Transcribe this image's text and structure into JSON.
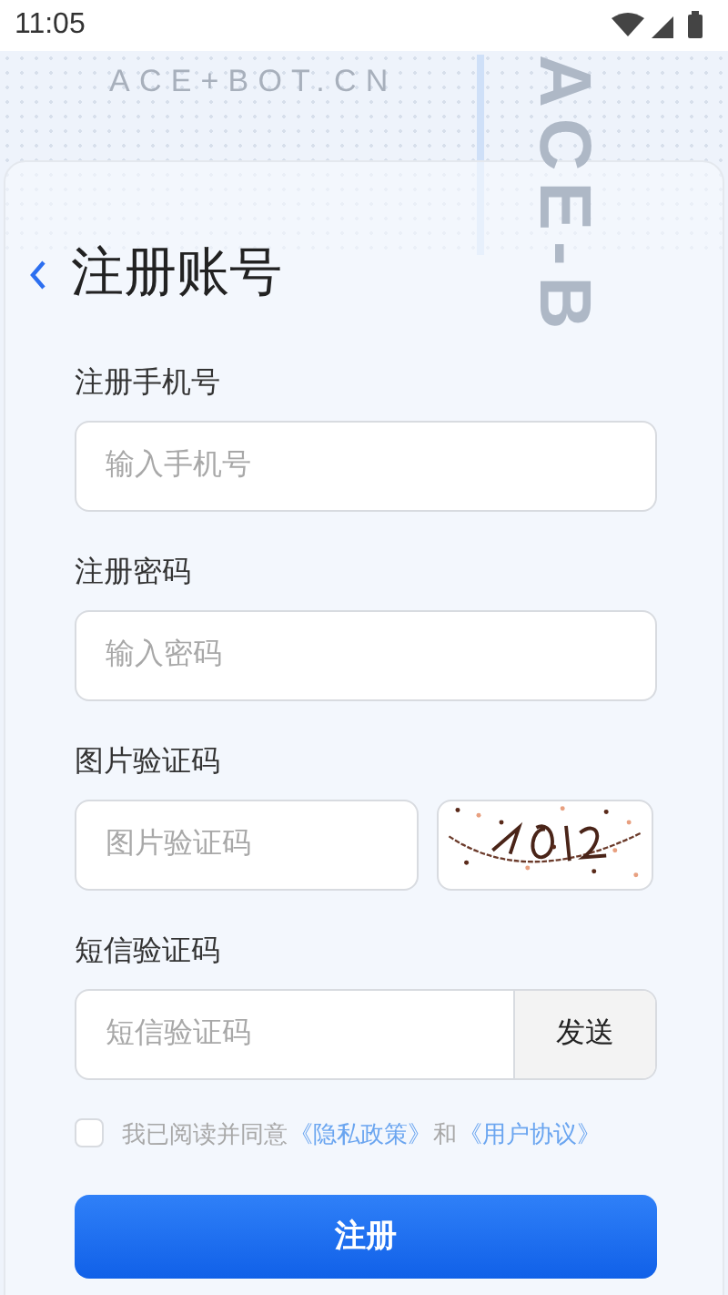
{
  "status_bar": {
    "time": "11:05"
  },
  "decor": {
    "header_text": "ACE+BOT.CN",
    "vertical_text": "ACE-B"
  },
  "title": "注册账号",
  "fields": [
    {
      "kind": "text",
      "label": "注册手机号",
      "placeholder": "输入手机号"
    },
    {
      "kind": "text",
      "label": "注册密码",
      "placeholder": "输入密码"
    },
    {
      "kind": "captcha",
      "label": "图片验证码",
      "placeholder": "图片验证码"
    },
    {
      "kind": "sms",
      "label": "短信验证码",
      "placeholder": "短信验证码",
      "button": "发送"
    }
  ],
  "agreement": {
    "checked": false,
    "text": "我已阅读并同意",
    "link1": "《隐私政策》",
    "conjunction": "和",
    "link2": "《用户协议》"
  },
  "submit": "注册"
}
